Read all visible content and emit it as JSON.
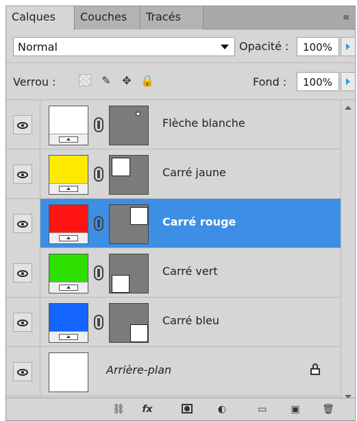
{
  "tabs": [
    {
      "label": "Calques",
      "active": true
    },
    {
      "label": "Couches",
      "active": false
    },
    {
      "label": "Tracés",
      "active": false
    }
  ],
  "controls": {
    "blend_mode": "Normal",
    "opacity_label": "Opacité :",
    "opacity_value": "100%",
    "lock_label": "Verrou :",
    "fond_label": "Fond :",
    "fond_value": "100%"
  },
  "layers": [
    {
      "name": "Flèche blanche",
      "color": "#ffffff",
      "selected": false
    },
    {
      "name": "Carré jaune",
      "color": "#ffea00",
      "selected": false
    },
    {
      "name": "Carré rouge",
      "color": "#ff1414",
      "selected": true
    },
    {
      "name": "Carré vert",
      "color": "#2ee000",
      "selected": false
    },
    {
      "name": "Carré bleu",
      "color": "#1464ff",
      "selected": false
    },
    {
      "name": "Arrière-plan",
      "color": "#ffffff",
      "selected": false,
      "background": true
    }
  ],
  "icons": {
    "panel_menu": "menu-icon",
    "dropdown": "chevron-down-icon",
    "lock_transparent": "checkerboard-icon",
    "lock_brush": "brush-icon",
    "lock_move": "move-icon",
    "lock_all": "lock-icon",
    "eye": "eye-icon",
    "chain": "link-icon",
    "background_lock": "lock-icon",
    "toolbar_link": "link-icon",
    "toolbar_fx": "fx-icon",
    "toolbar_mask": "mask-icon",
    "toolbar_adjustment": "adjustment-icon",
    "toolbar_group": "folder-icon",
    "toolbar_new": "new-layer-icon",
    "toolbar_delete": "trash-icon"
  },
  "toolbar": {
    "fx_label": "fx"
  }
}
